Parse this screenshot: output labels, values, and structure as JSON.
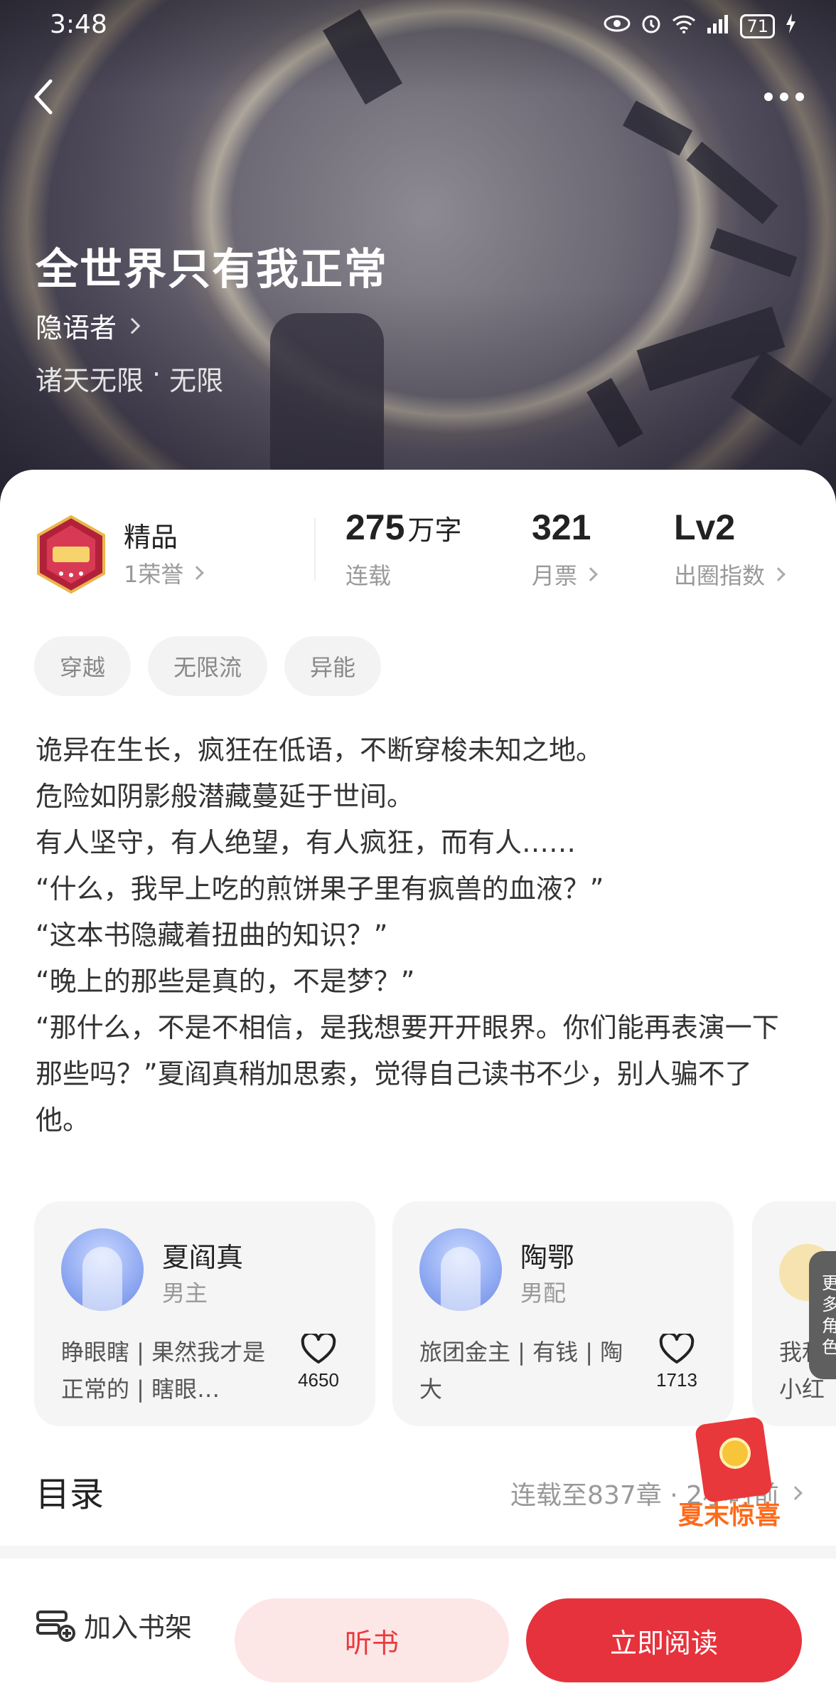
{
  "status_bar": {
    "time": "3:48",
    "battery": "71"
  },
  "book": {
    "title": "全世界只有我正常",
    "author": "隐语者",
    "genre": "诸天无限",
    "subgenre": "无限",
    "separator": "·"
  },
  "stats": {
    "badge_label": "精品",
    "badge_sub": "1荣誉",
    "word_count": "275",
    "word_unit": "万字",
    "word_label": "连载",
    "monthly_votes": "321",
    "monthly_label": "月票",
    "circle_index": "Lv2",
    "circle_label": "出圈指数"
  },
  "tags": [
    "穿越",
    "无限流",
    "异能"
  ],
  "synopsis": [
    "诡异在生长，疯狂在低语，不断穿梭未知之地。",
    "危险如阴影般潜藏蔓延于世间。",
    "有人坚守，有人绝望，有人疯狂，而有人……",
    "“什么，我早上吃的煎饼果子里有疯兽的血液？”",
    "“这本书隐藏着扭曲的知识？”",
    "“晚上的那些是真的，不是梦？”",
    "“那什么，不是不相信，是我想要开开眼界。你们能再表演一下那些吗？”夏阎真稍加思索，觉得自己读书不少，别人骗不了他。"
  ],
  "characters": [
    {
      "name": "夏阎真",
      "role": "男主",
      "desc": "睁眼瞎 | 果然我才是正常的 | 瞎眼…",
      "likes": "4650"
    },
    {
      "name": "陶鄂",
      "role": "男配",
      "desc": "旅团金主 | 有钱 | 陶大",
      "likes": "1713"
    }
  ],
  "char_peek": {
    "line1": "我和-",
    "line2": "小红"
  },
  "more_roles": [
    "更",
    "多",
    "角",
    "色"
  ],
  "toc": {
    "title": "目录",
    "info": "连载至837章 · 2小时前"
  },
  "promo": {
    "text": "夏末惊喜"
  },
  "bottom": {
    "shelf": "加入书架",
    "listen": "听书",
    "read": "立即阅读"
  },
  "colors": {
    "accent": "#e6323c",
    "accent_soft": "#fde6e6",
    "promo": "#ff6a1a"
  }
}
